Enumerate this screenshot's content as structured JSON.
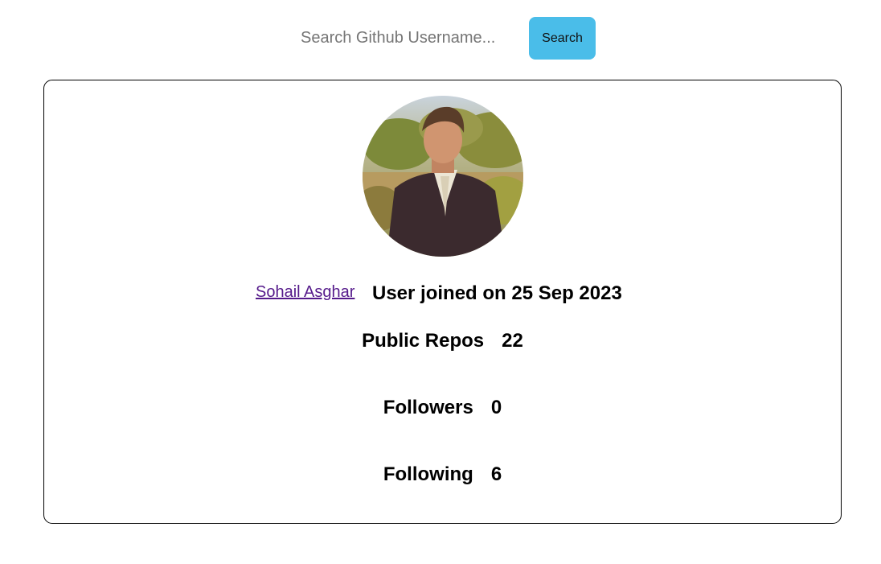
{
  "search": {
    "placeholder": "Search Github Username...",
    "value": "",
    "button_label": "Search"
  },
  "profile": {
    "name": "Sohail Asghar",
    "joined_text": "User joined on 25 Sep 2023",
    "stats": {
      "public_repos": {
        "label": "Public Repos",
        "value": "22"
      },
      "followers": {
        "label": "Followers",
        "value": "0"
      },
      "following": {
        "label": "Following",
        "value": "6"
      }
    }
  },
  "colors": {
    "search_button_bg": "#4abde9",
    "link_visited": "#551a8b",
    "card_border": "#000000"
  }
}
